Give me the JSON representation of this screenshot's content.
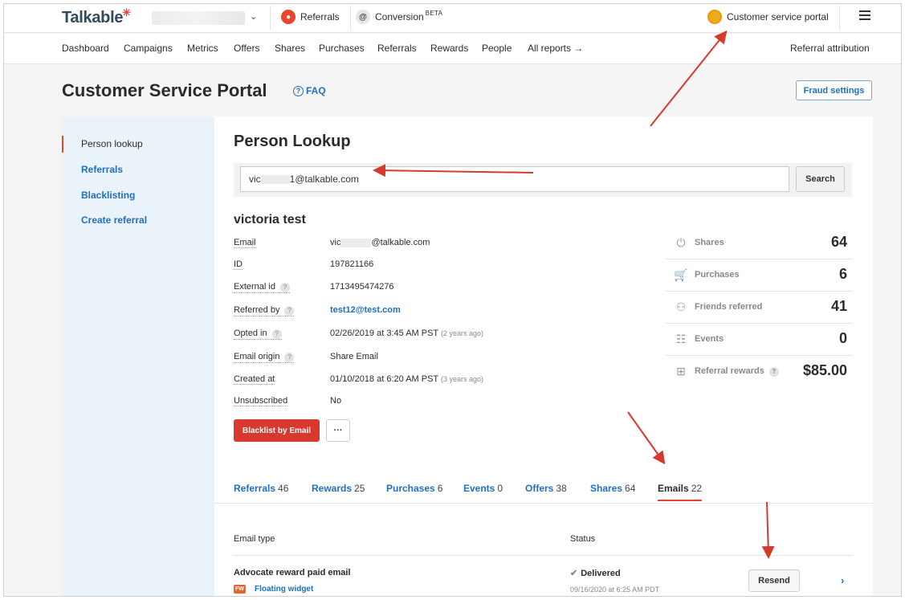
{
  "topbar": {
    "logo": "Talkable",
    "nav": [
      {
        "label": "Referrals",
        "icon": "referrals-icon"
      },
      {
        "label": "Conversion",
        "badge": "BETA",
        "icon": "at-sign-icon"
      }
    ],
    "portal": {
      "label": "Customer service portal",
      "icon": "user-circle-icon"
    },
    "menu_icon": "hamburger-icon"
  },
  "subnav": {
    "items": [
      "Dashboard",
      "Campaigns",
      "Metrics",
      "Offers",
      "Shares",
      "Purchases",
      "Referrals",
      "Rewards",
      "People"
    ],
    "all_reports": "All reports →",
    "right": "Referral attribution"
  },
  "header": {
    "title": "Customer Service Portal",
    "faq": "FAQ",
    "fraud_settings": "Fraud settings"
  },
  "sidebar": {
    "items": [
      {
        "label": "Person lookup",
        "active": true
      },
      {
        "label": "Referrals"
      },
      {
        "label": "Blacklisting"
      },
      {
        "label": "Create referral"
      }
    ]
  },
  "lookup": {
    "title": "Person Lookup",
    "query_prefix": "vic",
    "query_suffix": "1@talkable.com",
    "search_button": "Search"
  },
  "person": {
    "name": "victoria test",
    "fields": [
      {
        "label": "Email",
        "value_prefix": "vic",
        "value_suffix": "@talkable.com"
      },
      {
        "label": "ID",
        "value": "197821166"
      },
      {
        "label": "External id",
        "value": "1713495474276",
        "help": "?"
      },
      {
        "label": "Referred by",
        "value": "test12@test.com",
        "help": "?"
      },
      {
        "label": "Opted in",
        "value": "02/26/2019 at 3:45 AM PST",
        "note": "(2 years ago)",
        "help": "?"
      },
      {
        "label": "Email origin",
        "value": "Share Email",
        "help": "?"
      },
      {
        "label": "Created at",
        "value": "01/10/2018 at 6:20 AM PST",
        "note": "(3 years ago)"
      },
      {
        "label": "Unsubscribed",
        "value": "No"
      }
    ],
    "blacklist_button": "Blacklist by Email",
    "more_button": "···"
  },
  "stats": [
    {
      "label": "Shares",
      "value": "64",
      "icon": "share-icon"
    },
    {
      "label": "Purchases",
      "value": "6",
      "icon": "cart-icon"
    },
    {
      "label": "Friends referred",
      "value": "41",
      "icon": "friends-icon"
    },
    {
      "label": "Events",
      "value": "0",
      "icon": "list-icon"
    },
    {
      "label": "Referral rewards",
      "value": "$85.00",
      "icon": "gift-icon"
    }
  ],
  "tabs": [
    {
      "label": "Referrals",
      "count": "46"
    },
    {
      "label": "Rewards",
      "count": "25"
    },
    {
      "label": "Purchases",
      "count": "6"
    },
    {
      "label": "Events",
      "count": "0"
    },
    {
      "label": "Offers",
      "count": "38"
    },
    {
      "label": "Shares",
      "count": "64"
    },
    {
      "label": "Emails",
      "count": "22",
      "active": true
    }
  ],
  "emails_table": {
    "headers": {
      "type": "Email type",
      "status": "Status"
    },
    "rows": [
      {
        "type": "Advocate reward paid email",
        "badge": "FW",
        "source": "Floating widget",
        "status": "Delivered",
        "status_time": "09/16/2020 at 6:25 AM PDT",
        "action": "Resend"
      }
    ]
  },
  "colors": {
    "brand_red": "#e8452c",
    "link_blue": "#1f6fbf",
    "annotation_arrow": "#d63a2f"
  }
}
